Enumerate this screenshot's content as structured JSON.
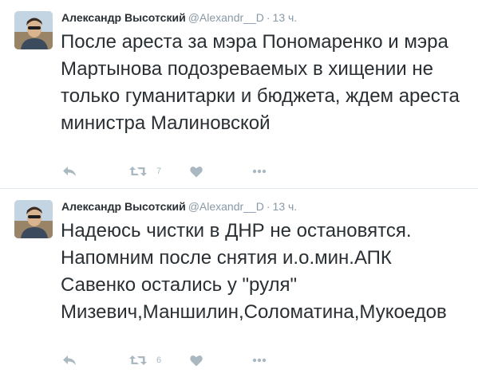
{
  "tweets": [
    {
      "fullname": "Александр Высотский",
      "username": "@Alexandr__D",
      "dot": "·",
      "time": "13 ч.",
      "text": "После ареста за мэра Пономаренко и мэра Мартынова подозреваемых в хищении не только гуманитарки и бюджета, ждем ареста министра Малиновской",
      "retweet_count": "7",
      "icons": [
        "reply-icon",
        "retweet-icon",
        "like-icon",
        "more-icon"
      ]
    },
    {
      "fullname": "Александр Высотский",
      "username": "@Alexandr__D",
      "dot": "·",
      "time": "13 ч.",
      "text": "Надеюсь чистки в ДНР не остановятся. Напомним после снятия и.о.мин.АПК Савенко остались у \"руля\" Мизевич,Маншилин,Соломатина,Мукоедов",
      "retweet_count": "6",
      "icons": [
        "reply-icon",
        "retweet-icon",
        "like-icon",
        "more-icon"
      ]
    }
  ],
  "colors": {
    "text": "#292f33",
    "muted": "#8899a6",
    "icon": "#aab8c2",
    "divider": "#e1e8ed"
  }
}
